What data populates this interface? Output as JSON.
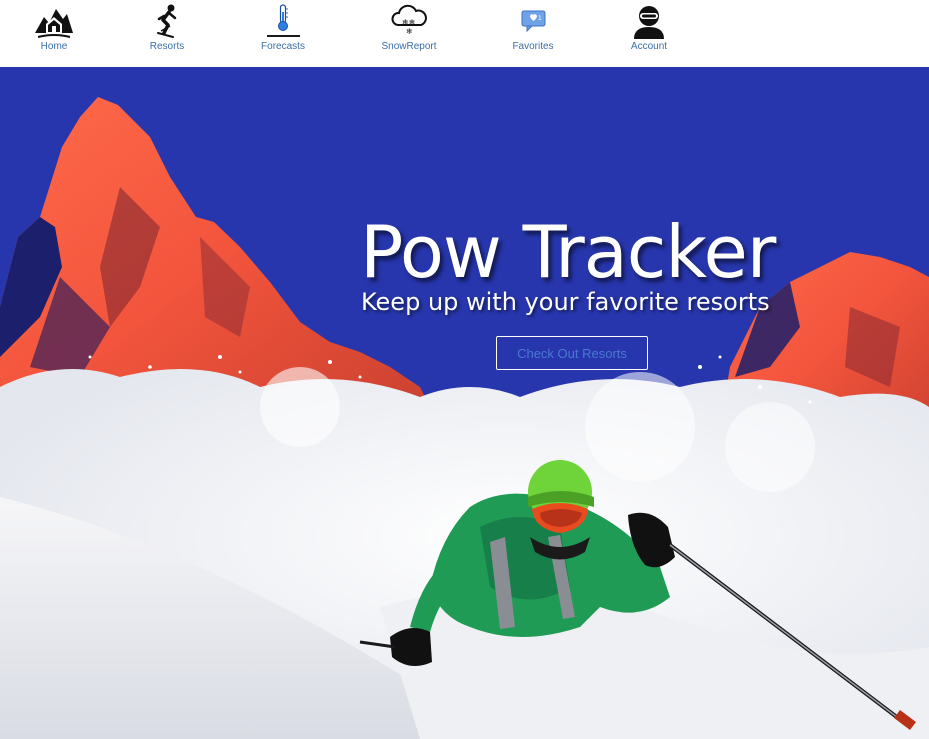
{
  "nav": {
    "items": [
      {
        "label": "Home",
        "icon": "house-mountain-icon"
      },
      {
        "label": "Resorts",
        "icon": "skier-icon"
      },
      {
        "label": "Forecasts",
        "icon": "thermometer-icon"
      },
      {
        "label": "SnowReport",
        "icon": "snow-cloud-icon"
      },
      {
        "label": "Favorites",
        "icon": "heart-speech-bubble-icon",
        "badge": "1"
      },
      {
        "label": "Account",
        "icon": "skier-helmet-avatar-icon"
      }
    ],
    "active": "Forecasts"
  },
  "hero": {
    "title": "Pow Tracker",
    "subtitle": "Keep up with your favorite resorts",
    "button_label": "Check Out Resorts"
  },
  "colors": {
    "sky": "#2736ad",
    "nav_label": "#3b6ea5",
    "button_text": "#4a78cf",
    "mountain_glow": "#f2543c",
    "jacket": "#1f9b55",
    "helmet": "#6fd33a"
  }
}
